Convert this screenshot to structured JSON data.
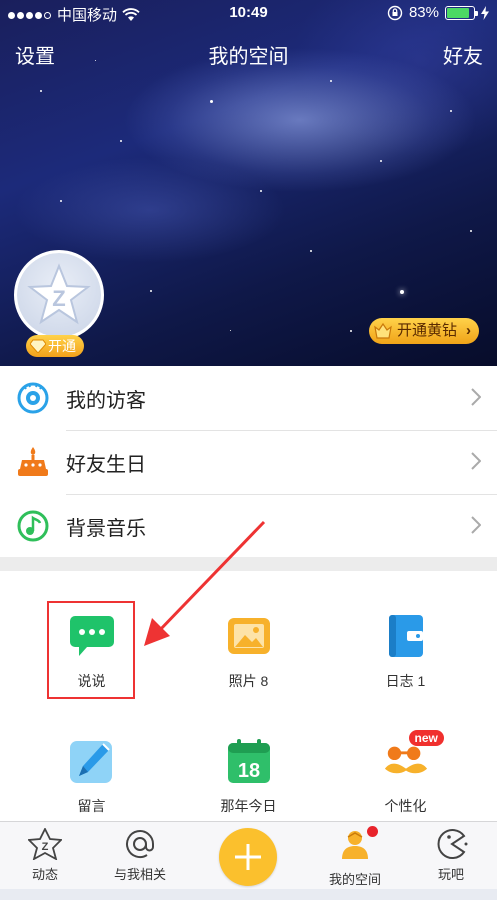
{
  "status_bar": {
    "carrier": "中国移动",
    "time": "10:49",
    "battery": "83%",
    "battery_level": 0.83
  },
  "nav": {
    "left": "设置",
    "title": "我的空间",
    "right": "好友"
  },
  "profile": {
    "open_badge": "开通",
    "gold_button": "开通黄钻"
  },
  "list": [
    {
      "label": "我的访客",
      "icon": "eye-icon"
    },
    {
      "label": "好友生日",
      "icon": "birthday-cake-icon"
    },
    {
      "label": "背景音乐",
      "icon": "music-note-icon"
    }
  ],
  "grid": [
    {
      "label": "说说",
      "icon": "chat-bubble-icon",
      "color": "#1fc36a"
    },
    {
      "label": "照片 8",
      "icon": "photo-icon",
      "color": "#f7b12b"
    },
    {
      "label": "日志 1",
      "icon": "journal-icon",
      "color": "#2a9ae8"
    },
    {
      "label": "留言",
      "icon": "pen-icon",
      "color": "#3aaeea"
    },
    {
      "label": "那年今日",
      "icon": "calendar-icon",
      "color": "#2fbf6a"
    },
    {
      "label": "个性化",
      "icon": "mustache-face-icon",
      "color": "#f39a1e",
      "badge": "new"
    }
  ],
  "tabs": [
    {
      "label": "动态",
      "icon": "star-z-icon"
    },
    {
      "label": "与我相关",
      "icon": "at-icon"
    },
    {
      "label": "",
      "icon": "plus-icon"
    },
    {
      "label": "我的空间",
      "icon": "person-icon"
    },
    {
      "label": "玩吧",
      "icon": "pacman-icon"
    }
  ],
  "colors": {
    "accent_yellow": "#fbc02d",
    "highlight_red": "#e33333"
  }
}
